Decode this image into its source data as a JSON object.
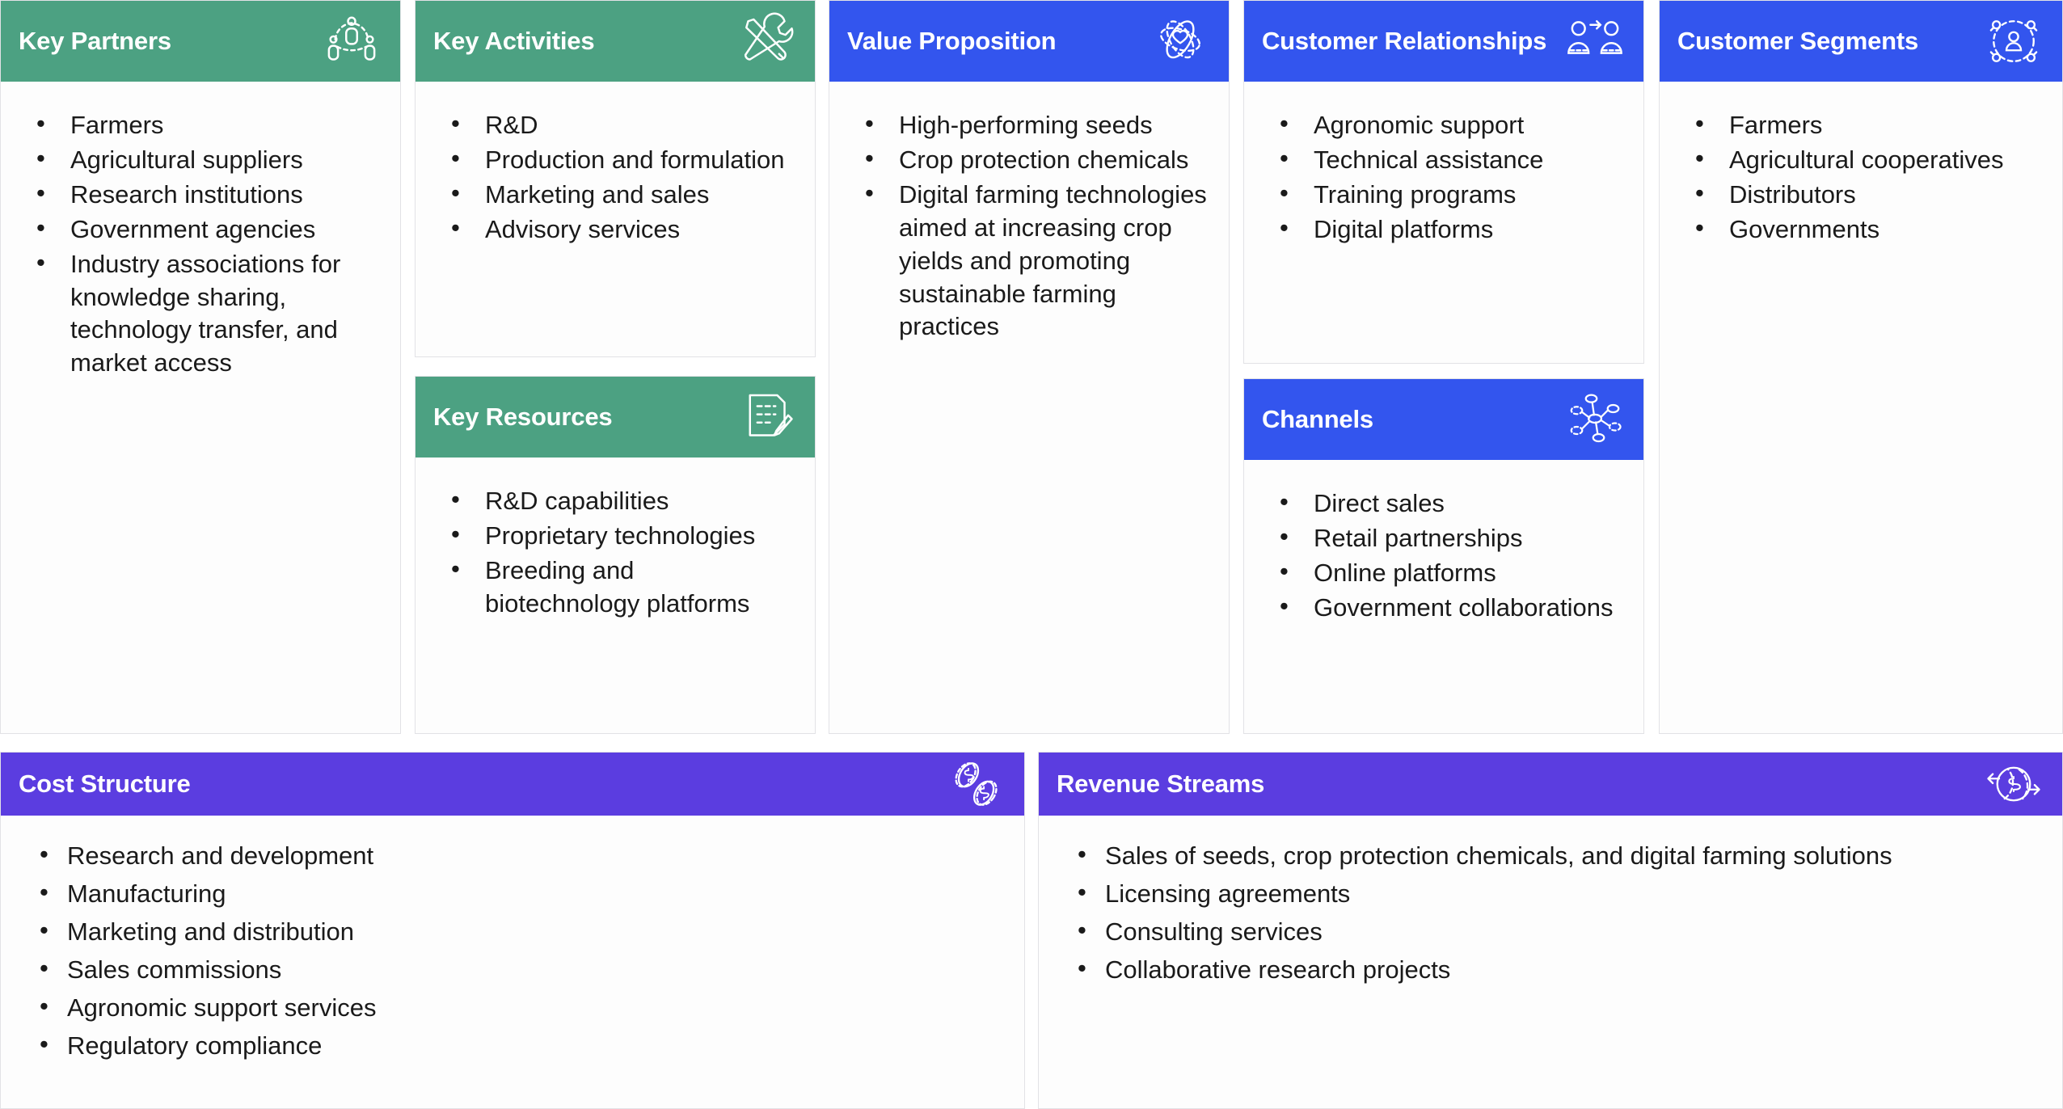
{
  "colors": {
    "green": "#4ca182",
    "blue": "#3355ee",
    "purple": "#5b3de0",
    "panel_bg": "#fdfdfd",
    "text": "#1a1a1a",
    "header_text": "#ffffff"
  },
  "blocks": {
    "key_partners": {
      "title": "Key Partners",
      "icon": "partners-network-icon",
      "items": [
        "Farmers",
        "Agricultural suppliers",
        "Research institutions",
        "Government agencies",
        "Industry associations for knowledge sharing, technology transfer, and market access"
      ]
    },
    "key_activities": {
      "title": "Key Activities",
      "icon": "tools-wrench-screwdriver-icon",
      "items": [
        "R&D",
        "Production and formulation",
        "Marketing and sales",
        "Advisory services"
      ]
    },
    "key_resources": {
      "title": "Key Resources",
      "icon": "document-pencil-icon",
      "items": [
        "R&D capabilities",
        "Proprietary technologies",
        "Breeding and biotechnology platforms"
      ]
    },
    "value_proposition": {
      "title": "Value Proposition",
      "icon": "atom-heart-icon",
      "items": [
        "High-performing seeds",
        "Crop protection chemicals",
        "Digital farming technologies aimed at increasing crop yields and promoting sustainable farming practices"
      ]
    },
    "customer_relationships": {
      "title": "Customer Relationships",
      "icon": "two-people-arrow-icon",
      "items": [
        "Agronomic support",
        "Technical assistance",
        "Training programs",
        "Digital platforms"
      ]
    },
    "channels": {
      "title": "Channels",
      "icon": "distribution-network-icon",
      "items": [
        "Direct sales",
        "Retail partnerships",
        "Online platforms",
        "Government collaborations"
      ]
    },
    "customer_segments": {
      "title": "Customer Segments",
      "icon": "target-audience-icon",
      "items": [
        "Farmers",
        "Agricultural cooperatives",
        "Distributors",
        "Governments"
      ]
    },
    "cost_structure": {
      "title": "Cost Structure",
      "icon": "coins-dollar-icon",
      "items": [
        "Research and development",
        "Manufacturing",
        "Marketing and distribution",
        "Sales commissions",
        "Agronomic support services",
        "Regulatory compliance"
      ]
    },
    "revenue_streams": {
      "title": "Revenue Streams",
      "icon": "money-flow-circle-icon",
      "items": [
        "Sales of seeds, crop protection chemicals, and digital farming solutions",
        "Licensing agreements",
        "Consulting services",
        "Collaborative research projects"
      ]
    }
  }
}
